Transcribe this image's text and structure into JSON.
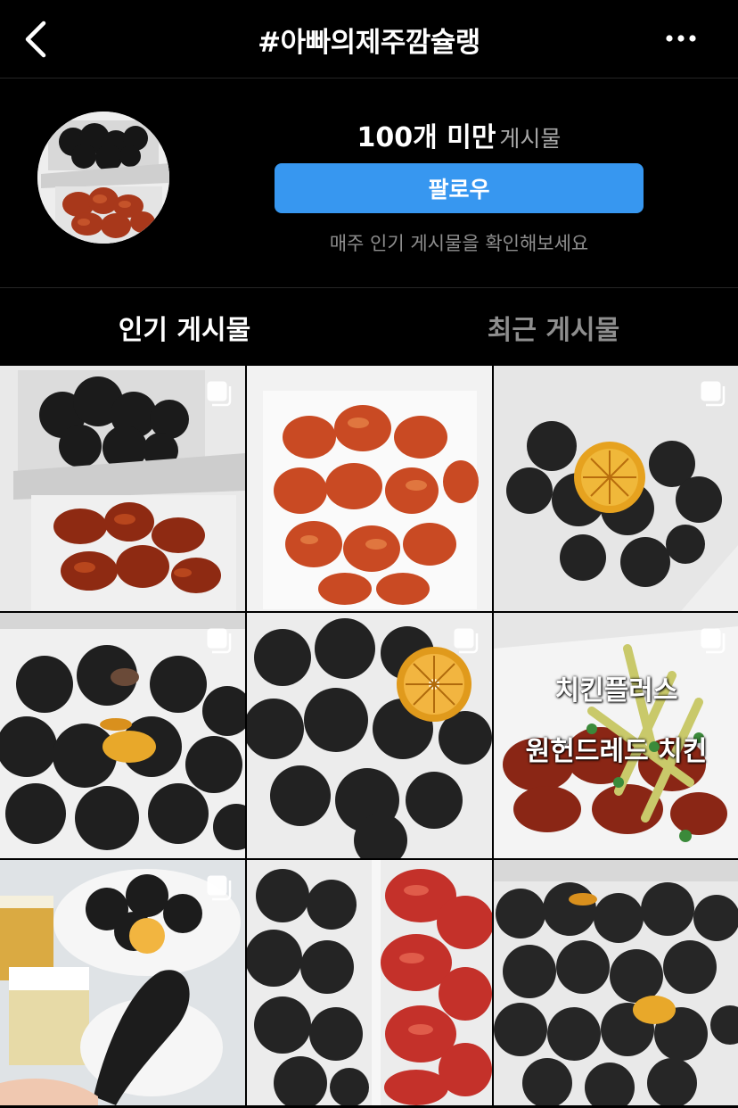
{
  "header": {
    "title": "#아빠의제주깜슐랭",
    "back_icon": "chevron-left-icon",
    "more_icon": "more-horizontal-icon"
  },
  "profile": {
    "post_count": "100개 미만",
    "post_label": "게시물",
    "follow_label": "팔로우",
    "helper_text": "매주 인기 게시물을 확인해보세요",
    "follow_color": "#3797f0"
  },
  "tabs": [
    {
      "label": "인기 게시물",
      "active": true
    },
    {
      "label": "최근 게시물",
      "active": false
    }
  ],
  "grid": {
    "posts": [
      {
        "subject": "black and red chicken boxes",
        "multi": true
      },
      {
        "subject": "red sauced chicken",
        "multi": false
      },
      {
        "subject": "black chicken with orange slice",
        "multi": true
      },
      {
        "subject": "black chicken with dried orange",
        "multi": true
      },
      {
        "subject": "black chicken with orange slice",
        "multi": true
      },
      {
        "subject": "chicken with green topping",
        "multi": true,
        "overlay_lines": [
          "치킨플러스",
          "원헌드레드 치킨"
        ]
      },
      {
        "subject": "black drumstick with beer",
        "multi": true
      },
      {
        "subject": "black and red chicken",
        "multi": false
      },
      {
        "subject": "black chicken box with orange",
        "multi": false
      }
    ]
  }
}
